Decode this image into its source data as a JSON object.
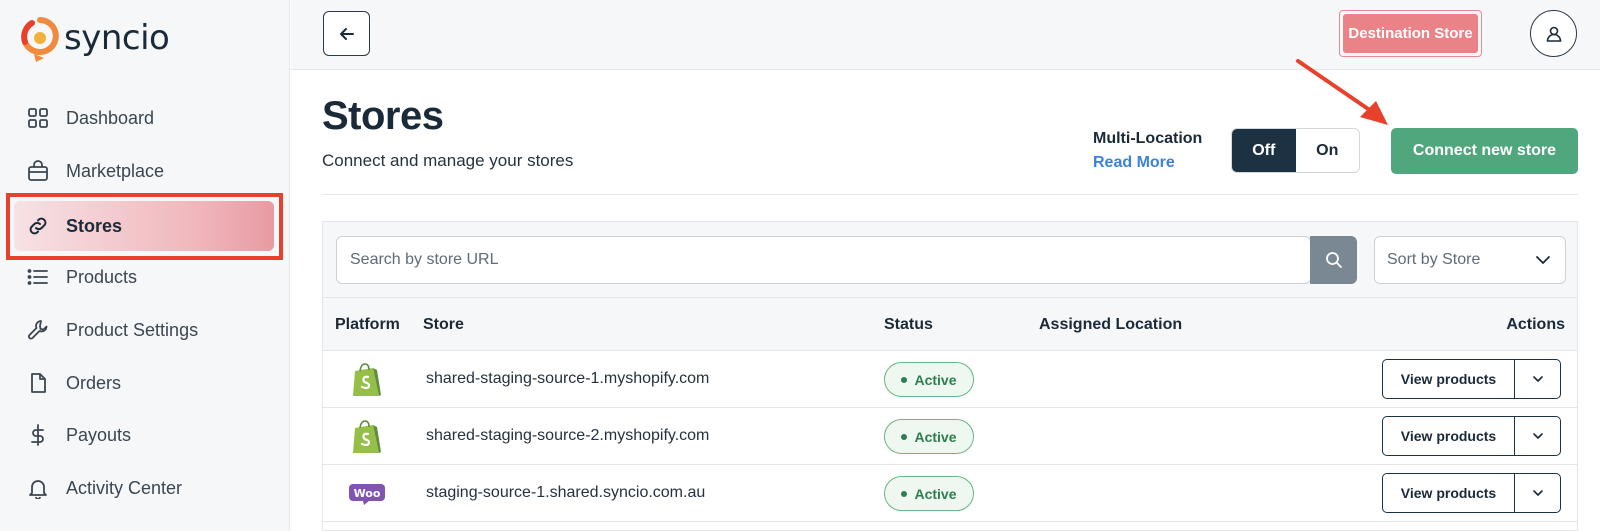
{
  "app": {
    "logo_text": "syncio"
  },
  "sidebar": {
    "items": [
      {
        "label": "Dashboard",
        "icon": "grid-icon"
      },
      {
        "label": "Marketplace",
        "icon": "shopping-bag-icon"
      },
      {
        "label": "Stores",
        "icon": "link-icon",
        "active": true
      },
      {
        "label": "Products",
        "icon": "list-icon"
      },
      {
        "label": "Product Settings",
        "icon": "wrench-icon"
      },
      {
        "label": "Orders",
        "icon": "file-icon"
      },
      {
        "label": "Payouts",
        "icon": "dollar-icon"
      },
      {
        "label": "Activity Center",
        "icon": "bell-icon"
      }
    ]
  },
  "topbar": {
    "destination_label": "Destination Store",
    "back_icon": "arrow-left-icon",
    "user_icon": "user-icon"
  },
  "header": {
    "title": "Stores",
    "subtitle": "Connect and manage your stores",
    "multi_location_label": "Multi-Location",
    "read_more": "Read More",
    "toggle_off": "Off",
    "toggle_on": "On",
    "toggle_value": "Off",
    "connect_label": "Connect new store"
  },
  "toolbar": {
    "search_placeholder": "Search by store URL",
    "sort_label": "Sort by Store"
  },
  "table": {
    "columns": [
      "Platform",
      "Store",
      "Status",
      "Assigned Location",
      "Actions"
    ],
    "rows": [
      {
        "platform": "shopify-icon",
        "store": "shared-staging-source-1.myshopify.com",
        "status": "Active",
        "action": "View products"
      },
      {
        "platform": "shopify-icon",
        "store": "shared-staging-source-2.myshopify.com",
        "status": "Active",
        "action": "View products"
      },
      {
        "platform": "woo-icon",
        "platform_text": "Woo",
        "store": "staging-source-1.shared.syncio.com.au",
        "status": "Active",
        "action": "View products"
      }
    ]
  },
  "colors": {
    "accent_green": "#50a77e",
    "destination_pink": "#ea8388",
    "annotation_red": "#e8412b",
    "toggle_active": "#1c3142"
  }
}
